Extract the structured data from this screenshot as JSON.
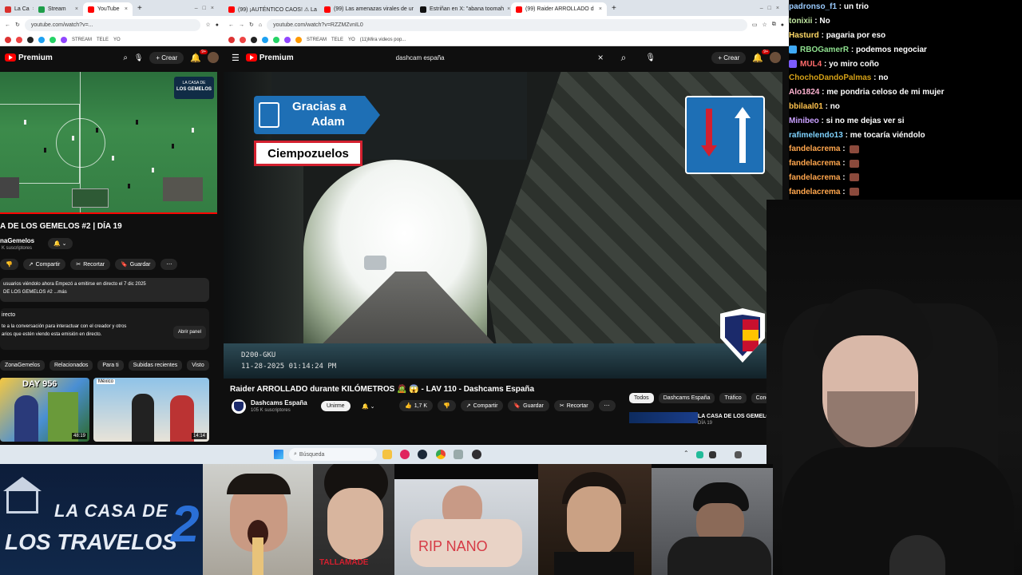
{
  "left_window": {
    "tabs": [
      {
        "label": "La Ca",
        "color": "#d9302c"
      },
      {
        "label": "Stream",
        "color": "#1e9e4a"
      },
      {
        "label": "YouTube",
        "color": "#ff0000"
      }
    ],
    "url": "youtube.com/watch?v=...",
    "bookmarks": [
      "STREAM",
      "TELE",
      "YO"
    ],
    "logo": "Premium",
    "create_label": "Crear",
    "notif_count": "9+",
    "video_overlay_top": "LA CASA DE",
    "video_overlay_bottom": "LOS GEMELOS",
    "title": "A DE LOS GEMELOS #2 | DÍA 19",
    "channel": "naGemelos",
    "subscribers": "K suscriptores",
    "share_label": "Compartir",
    "clip_label": "Recortar",
    "save_label": "Guardar",
    "desc_line1": "usuarios viéndolo ahora  Empezó a emitirse en directo el 7 dic 2025",
    "desc_line2": "DE LOS GEMELOS #2 ...más",
    "chat_heading": "irecto",
    "chat_line1": "te a la conversación para interactuar con el creador y otros",
    "chat_line2": "arios que estén viendo esta emisión en directo.",
    "open_panel": "Abrir panel",
    "chips": [
      "ZonaGemelos",
      "Relacionados",
      "Para ti",
      "Subidas recientes",
      "Visto"
    ],
    "thumb1_tag": "DAY 956",
    "thumb1_time": "48:19",
    "thumb2_tag": "México",
    "thumb2_time": "14:14"
  },
  "main_window": {
    "tabs": [
      {
        "label": "(99) ¡AUTÉNTICO CAOS! ⚠ La",
        "color": "#ff0000"
      },
      {
        "label": "(99) Las amenazas virales de ur",
        "color": "#ff0000"
      },
      {
        "label": "Estriñan en X: \"abana toomah",
        "color": "#111111"
      },
      {
        "label": "(99) Raider ARROLLADO d",
        "color": "#ff0000"
      }
    ],
    "url": "youtube.com/watch?v=RZZMZvnIL0",
    "bookmarks": [
      "STREAM",
      "TELE",
      "YO",
      "(11)Mira videos pop..."
    ],
    "logo": "Premium",
    "search_value": "dashcam españa",
    "create_label": "Crear",
    "notif_count": "9+",
    "sign_line1": "Gracias a",
    "sign_line2": "Adam",
    "sign_town": "Ciempozuelos",
    "dashcam_id": "D200-GKU",
    "dashcam_time": "11-28-2025 01:14:24 PM",
    "video_title": "Raider ARROLLADO durante KILÓMETROS 🧟 😱 - LAV 110 - Dashcams España",
    "channel": "Dashcams España",
    "subscribers": "105 K suscriptores",
    "join_label": "Unirme",
    "likes": "1,7 K",
    "share_label": "Compartir",
    "save_label": "Guardar",
    "clip_label": "Recortar",
    "filter_chips": [
      "Todos",
      "Dashcams España",
      "Tráfico",
      "Cond"
    ],
    "rec_title": "LA CASA DE LOS GEMELOS",
    "rec_sub": "DÍA 19"
  },
  "taskbar": {
    "search_placeholder": "Búsqueda"
  },
  "chat": [
    {
      "user": "padronso_f1",
      "text": "un trio",
      "color": "#9acbff",
      "badge": ""
    },
    {
      "user": "tonixii",
      "text": "No",
      "color": "#c0e6a0",
      "badge": ""
    },
    {
      "user": "Hasturd",
      "text": "pagaria por eso",
      "color": "#ffd966",
      "badge": ""
    },
    {
      "user": "RBOGamerR",
      "text": "podemos negociar",
      "color": "#8fe08f",
      "badge": "#3fa9f5"
    },
    {
      "user": "MUL4",
      "text": "yo miro coño",
      "color": "#ff6b6b",
      "badge": "#7b5cff"
    },
    {
      "user": "ChochoDandoPalmas",
      "text": "no",
      "color": "#d4a017",
      "badge": ""
    },
    {
      "user": "Alo1824",
      "text": "me pondria celoso de mi mujer",
      "color": "#ffb3d1",
      "badge": ""
    },
    {
      "user": "bbilaal01",
      "text": "no",
      "color": "#ffc24d",
      "badge": ""
    },
    {
      "user": "Minibeo",
      "text": "si no me dejas ver si",
      "color": "#c9a0ff",
      "badge": ""
    },
    {
      "user": "rafimelendo13",
      "text": "me tocaría viéndolo",
      "color": "#7fd3ff",
      "badge": ""
    },
    {
      "user": "fandelacrema",
      "text": "",
      "color": "#ffa64d",
      "badge": ""
    },
    {
      "user": "fandelacrema",
      "text": "",
      "color": "#ffa64d",
      "badge": ""
    },
    {
      "user": "fandelacrema",
      "text": "",
      "color": "#ffa64d",
      "badge": ""
    },
    {
      "user": "fandelacrema",
      "text": "",
      "color": "#ffa64d",
      "badge": ""
    }
  ],
  "bottom": {
    "logo_line1": "LA CASA DE",
    "logo_line2": "LOS TRAVELOS",
    "logo_number": "2",
    "caption1": "TALLAMADE",
    "caption2": "RIP NANO"
  }
}
